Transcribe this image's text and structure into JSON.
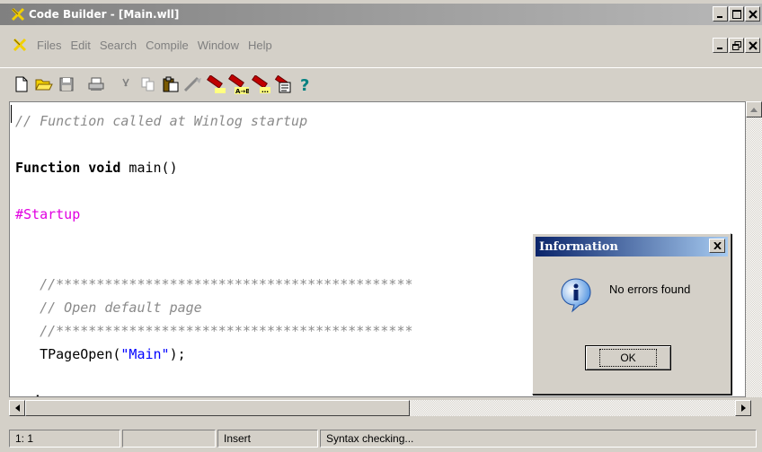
{
  "window": {
    "title": "Code Builder - [Main.wll]"
  },
  "menu": [
    "Files",
    "Edit",
    "Search",
    "Compile",
    "Window",
    "Help"
  ],
  "toolbar": {
    "icons": [
      "new-file-icon",
      "open-folder-icon",
      "save-icon",
      "print-icon",
      "cut-icon",
      "copy-icon",
      "paste-icon",
      "edit-tool-icon",
      "find-icon",
      "replace-icon",
      "find-next-icon",
      "properties-icon",
      "help-icon"
    ]
  },
  "editor": {
    "lines": [
      [
        {
          "t": "// Function called at Winlog startup",
          "c": "comment"
        }
      ],
      [],
      [
        {
          "t": "Function void",
          "c": "kw"
        },
        {
          "t": " main()",
          "c": ""
        }
      ],
      [],
      [
        {
          "t": "#Startup",
          "c": "dir"
        }
      ],
      [],
      [],
      [
        {
          "t": "   //********************************************",
          "c": "comment"
        }
      ],
      [
        {
          "t": "   // Open default page",
          "c": "comment"
        }
      ],
      [
        {
          "t": "   //********************************************",
          "c": "comment"
        }
      ],
      [
        {
          "t": "   TPageOpen(",
          "c": ""
        },
        {
          "t": "\"Main\"",
          "c": "str"
        },
        {
          "t": ");",
          "c": ""
        }
      ],
      [],
      [
        {
          "t": "end",
          "c": "kw"
        }
      ]
    ]
  },
  "dialog": {
    "title": "Information",
    "close": "X",
    "message": "No errors found",
    "ok_label": "OK"
  },
  "status": {
    "position": "1: 1",
    "pane2": "",
    "mode": "Insert",
    "message": "Syntax checking..."
  },
  "colors": {
    "comment": "#8a8a8a",
    "directive": "#e100e1",
    "string": "#0000ff",
    "dialog_title": "#0a246a"
  }
}
